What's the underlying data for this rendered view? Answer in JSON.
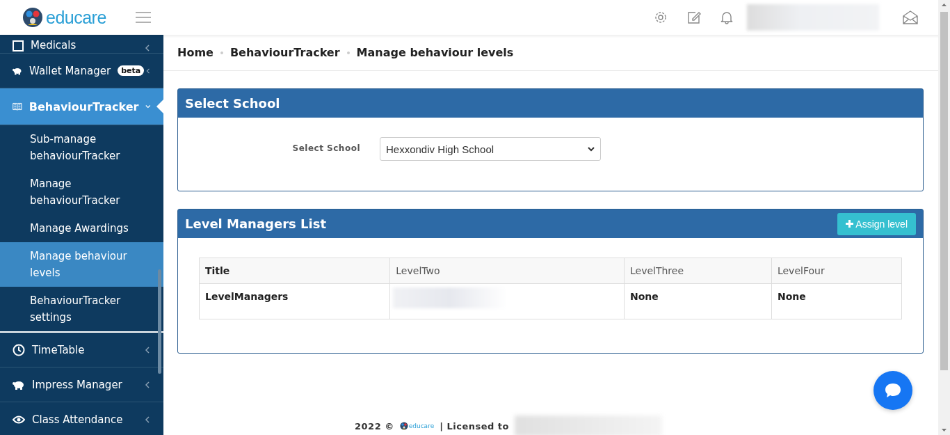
{
  "header": {
    "logo_text": "educare"
  },
  "sidebar": {
    "items": [
      {
        "label": "Medicals",
        "expanded": false,
        "selected": false
      },
      {
        "label": "Wallet Manager",
        "badge": "beta",
        "expanded": false,
        "selected": false
      },
      {
        "label": "BehaviourTracker",
        "expanded": true,
        "selected": true,
        "children": [
          {
            "label": "Sub-manage behaviourTracker",
            "selected": false
          },
          {
            "label": "Manage behaviourTracker",
            "selected": false
          },
          {
            "label": "Manage Awardings",
            "selected": false
          },
          {
            "label": "Manage behaviour levels",
            "selected": true
          },
          {
            "label": "BehaviourTracker settings",
            "selected": false
          }
        ]
      },
      {
        "label": "TimeTable",
        "expanded": false,
        "selected": false
      },
      {
        "label": "Impress Manager",
        "expanded": false,
        "selected": false
      },
      {
        "label": "Class Attendance",
        "expanded": false,
        "selected": false
      }
    ]
  },
  "breadcrumbs": [
    "Home",
    "BehaviourTracker",
    "Manage behaviour levels"
  ],
  "select_school_card": {
    "title": "Select School",
    "field_label": "Select School",
    "value": "Hexxondiv High School"
  },
  "level_card": {
    "title": "Level Managers List",
    "button": "Assign level",
    "table": {
      "columns": [
        "Title",
        "LevelTwo",
        "LevelThree",
        "LevelFour"
      ],
      "rows": [
        {
          "cells": [
            {
              "kind": "text",
              "text": "LevelManagers"
            },
            {
              "kind": "redacted"
            },
            {
              "kind": "text",
              "text": "None"
            },
            {
              "kind": "text",
              "text": "None"
            }
          ]
        }
      ]
    }
  },
  "footer": {
    "year": "2022 ©",
    "logo_text": "educare",
    "licensed": "| Licensed to"
  }
}
